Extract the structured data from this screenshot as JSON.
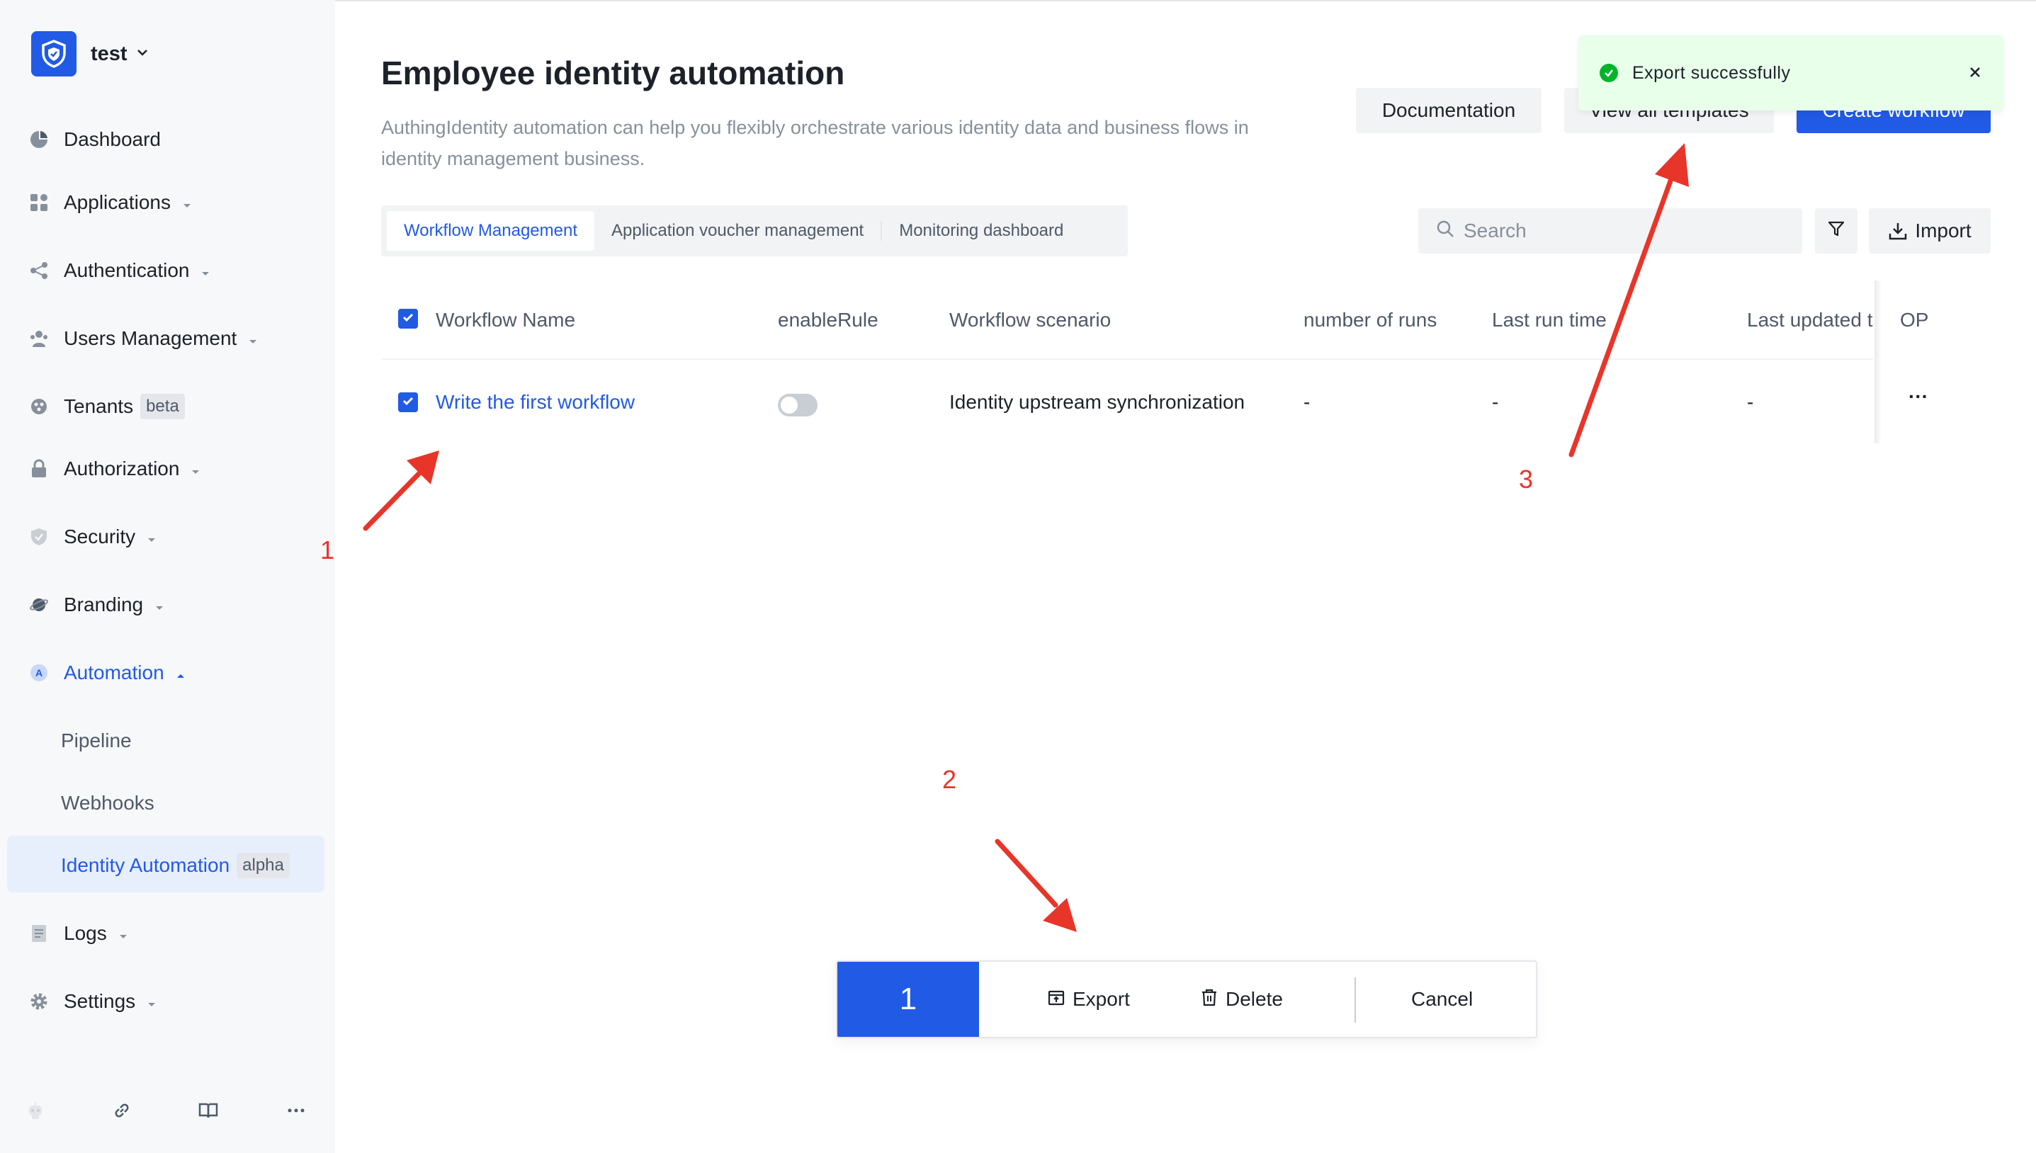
{
  "sidebar": {
    "tenant_name": "test",
    "items": [
      {
        "label": "Dashboard"
      },
      {
        "label": "Applications"
      },
      {
        "label": "Authentication"
      },
      {
        "label": "Users Management"
      },
      {
        "label": "Tenants",
        "tag": "beta"
      },
      {
        "label": "Authorization"
      },
      {
        "label": "Security"
      },
      {
        "label": "Branding"
      },
      {
        "label": "Automation"
      },
      {
        "label": "Logs"
      },
      {
        "label": "Settings"
      }
    ],
    "sub_items": [
      {
        "label": "Pipeline"
      },
      {
        "label": "Webhooks"
      },
      {
        "label": "Identity Automation",
        "tag": "alpha"
      }
    ]
  },
  "header": {
    "title": "Employee identity automation",
    "description": "AuthingIdentity automation can help you flexibly orchestrate various identity data and business flows in identity management business.",
    "documentation_label": "Documentation",
    "templates_label": "View all templates",
    "create_label": "Create workflow"
  },
  "tabs": [
    {
      "label": "Workflow Management"
    },
    {
      "label": "Application voucher management"
    },
    {
      "label": "Monitoring dashboard"
    }
  ],
  "search": {
    "placeholder": "Search"
  },
  "import_label": "Import",
  "table": {
    "columns": [
      "Workflow Name",
      "enableRule",
      "Workflow scenario",
      "number of runs",
      "Last run time",
      "Last updated t",
      "OP"
    ],
    "rows": [
      {
        "name": "Write the first workflow",
        "scenario": "Identity upstream synchronization",
        "runs": "-",
        "last_run": "-",
        "last_updated": "-",
        "op": "···"
      }
    ]
  },
  "toast": {
    "message": "Export successfully"
  },
  "batch": {
    "count": "1",
    "export_label": "Export",
    "delete_label": "Delete",
    "cancel_label": "Cancel"
  },
  "annotations": [
    "1",
    "2",
    "3"
  ],
  "colors": {
    "primary": "#215ae5",
    "annotation": "#e8352a",
    "success": "#00b42a"
  }
}
